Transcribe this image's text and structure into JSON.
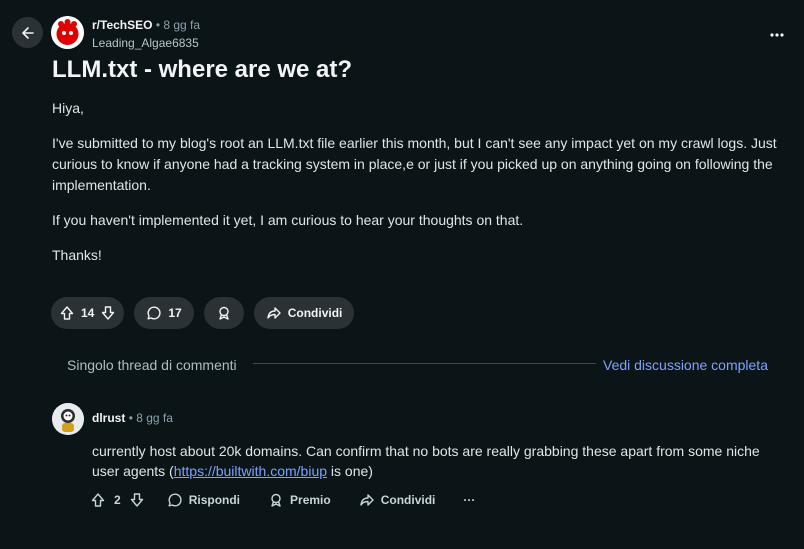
{
  "post": {
    "subreddit": "r/TechSEO",
    "dot": "•",
    "time": "8 gg fa",
    "author": "Leading_Algae6835",
    "title": "LLM.txt - where are we at?",
    "paragraphs": [
      "Hiya,",
      "I've submitted to my blog's root an LLM.txt file earlier this month, but I can't see any impact yet on my crawl logs. Just curious to know if anyone had a tracking system in place,e or just if you picked up on anything going on following the implementation.",
      "If you haven't implemented it yet, I am curious to hear your thoughts on that.",
      "Thanks!"
    ],
    "votes": "14",
    "comments": "17",
    "share_label": "Condividi"
  },
  "thread": {
    "label": "Singolo thread di commenti",
    "link": "Vedi discussione completa"
  },
  "comment": {
    "user": "dlrust",
    "dot": "•",
    "time": "8 gg fa",
    "text_before": "currently host about 20k domains. Can confirm that no bots are really grabbing these apart from some niche user agents (",
    "link": "https://builtwith.com/biup",
    "text_after": " is one)",
    "votes": "2",
    "reply_label": "Rispondi",
    "award_label": "Premio",
    "share_label": "Condividi",
    "more_label": "···"
  },
  "icons": {
    "back": "arrow-left-icon",
    "more": "more-horizontal-icon",
    "upvote": "upvote-arrow-icon",
    "downvote": "downvote-arrow-icon",
    "comment": "speech-bubble-icon",
    "award": "award-icon",
    "share": "share-arrow-icon"
  },
  "colors": {
    "background": "#0b1416",
    "pill": "#2a3236",
    "link": "#7ea2ff",
    "subreddit_avatar": "#e00000"
  }
}
